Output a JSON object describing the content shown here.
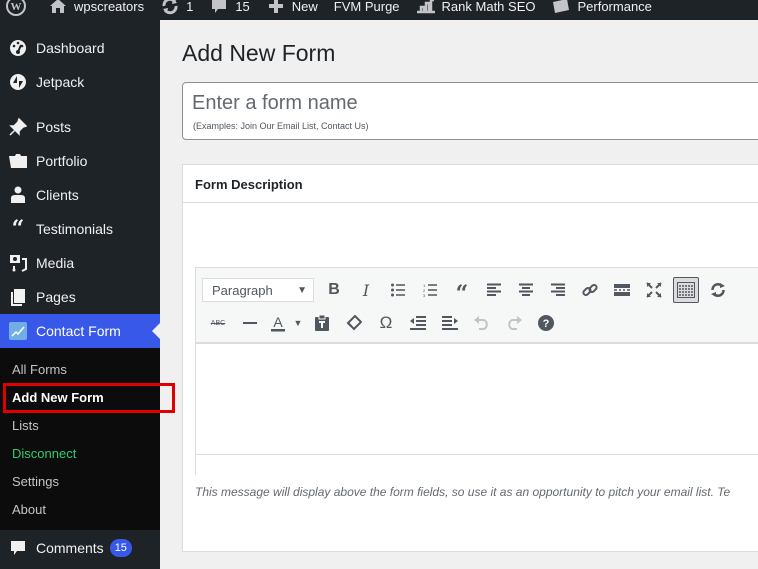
{
  "adminbar": {
    "site_name": "wpscreators",
    "updates_count": "1",
    "comments_count": "15",
    "new_label": "New",
    "fvm_label": "FVM Purge",
    "rankmath_label": "Rank Math SEO",
    "performance_label": "Performance"
  },
  "sidebar": {
    "items": [
      {
        "label": "Dashboard",
        "icon": "dashboard-icon"
      },
      {
        "label": "Jetpack",
        "icon": "jetpack-icon"
      },
      {
        "label": "Posts",
        "icon": "pin-icon"
      },
      {
        "label": "Portfolio",
        "icon": "folder-icon"
      },
      {
        "label": "Clients",
        "icon": "user-icon"
      },
      {
        "label": "Testimonials",
        "icon": "quote-icon"
      },
      {
        "label": "Media",
        "icon": "media-icon"
      },
      {
        "label": "Pages",
        "icon": "pages-icon"
      },
      {
        "label": "Contact Form",
        "icon": "contact-form-icon",
        "active": true
      }
    ],
    "submenu": [
      {
        "label": "All Forms"
      },
      {
        "label": "Add New Form",
        "current": true
      },
      {
        "label": "Lists"
      },
      {
        "label": "Disconnect",
        "color": "#2fcc71"
      },
      {
        "label": "Settings"
      },
      {
        "label": "About"
      }
    ],
    "comments": {
      "label": "Comments",
      "badge": "15"
    }
  },
  "main": {
    "page_title": "Add New Form",
    "form_name": {
      "value": "",
      "placeholder": "Enter a form name",
      "hint": "(Examples: Join Our Email List, Contact Us)"
    },
    "description": {
      "title": "Form Description",
      "format_select": "Paragraph",
      "help_text": "This message will display above the form fields, so use it as an opportunity to pitch your email list. Te"
    }
  },
  "colors": {
    "accent": "#3858e9",
    "sidebar_bg": "#1d2327",
    "submenu_bg": "#0c0c0c",
    "highlight": "#e00000"
  }
}
